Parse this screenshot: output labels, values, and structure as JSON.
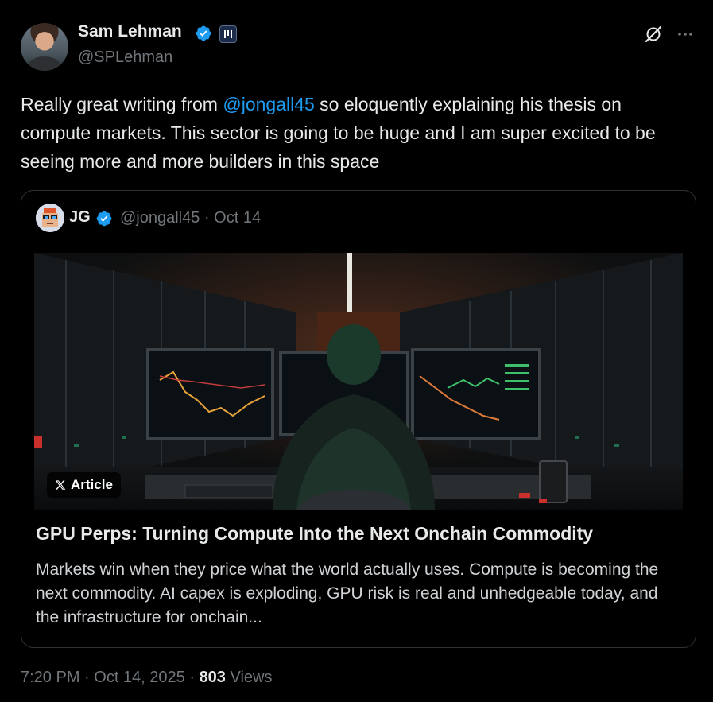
{
  "author": {
    "display_name": "Sam Lehman",
    "handle": "@SPLehman"
  },
  "tweet": {
    "text_before": "Really great writing from ",
    "mention": "@jongall45",
    "text_after": " so eloquently explaining his thesis on compute markets. This sector is going to be huge and I am super excited to be seeing more and more builders in this space"
  },
  "quote": {
    "display_name": "JG",
    "handle_date": "@jongall45 · Oct 14",
    "badge_label": "Article",
    "title": "GPU Perps: Turning Compute Into the Next Onchain Commodity",
    "description": "Markets win when they price what the world actually uses. Compute is becoming the next commodity. AI capex is exploding, GPU risk is real and unhedgeable today, and the infrastructure for onchain..."
  },
  "meta": {
    "timestamp": "7:20 PM · Oct 14, 2025 · ",
    "views_count": "803",
    "views_label": " Views"
  },
  "colors": {
    "background": "#000000",
    "accent": "#1d9bf0",
    "muted": "#71767b",
    "border": "#2f3336"
  },
  "icons": [
    "verified-badge-icon",
    "affiliate-badge-icon",
    "grok-icon",
    "more-icon",
    "x-logo-icon"
  ]
}
